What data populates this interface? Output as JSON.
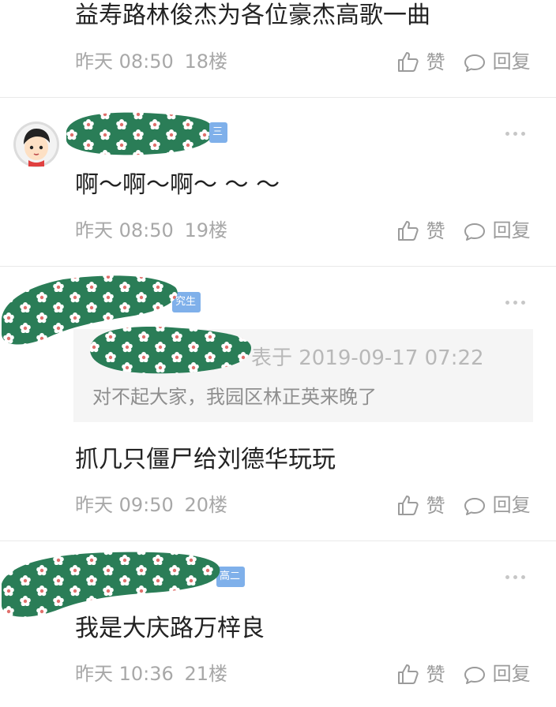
{
  "comments": [
    {
      "text": "益寿路林俊杰为各位豪杰高歌一曲",
      "time": "昨天 08:50",
      "floor": "18楼",
      "like_label": "赞",
      "reply_label": "回复"
    },
    {
      "badge": "三",
      "text": "啊～啊～啊～ ～ ～",
      "time": "昨天 08:50",
      "floor": "19楼",
      "like_label": "赞",
      "reply_label": "回复"
    },
    {
      "badge": "究生",
      "quote": {
        "meta": "表于 2019-09-17 07:22",
        "text": "对不起大家，我园区林正英来晚了"
      },
      "text": "抓几只僵尸给刘德华玩玩",
      "time": "昨天 09:50",
      "floor": "20楼",
      "like_label": "赞",
      "reply_label": "回复"
    },
    {
      "badge": "高二",
      "text": "我是大庆路万梓良",
      "time": "昨天 10:36",
      "floor": "21楼",
      "like_label": "赞",
      "reply_label": "回复"
    }
  ],
  "colors": {
    "redaction_green": "#2a7d57",
    "flower_petal": "#ffffff",
    "flower_center": "#e0706c",
    "badge_blue": "#7fb0ea"
  }
}
